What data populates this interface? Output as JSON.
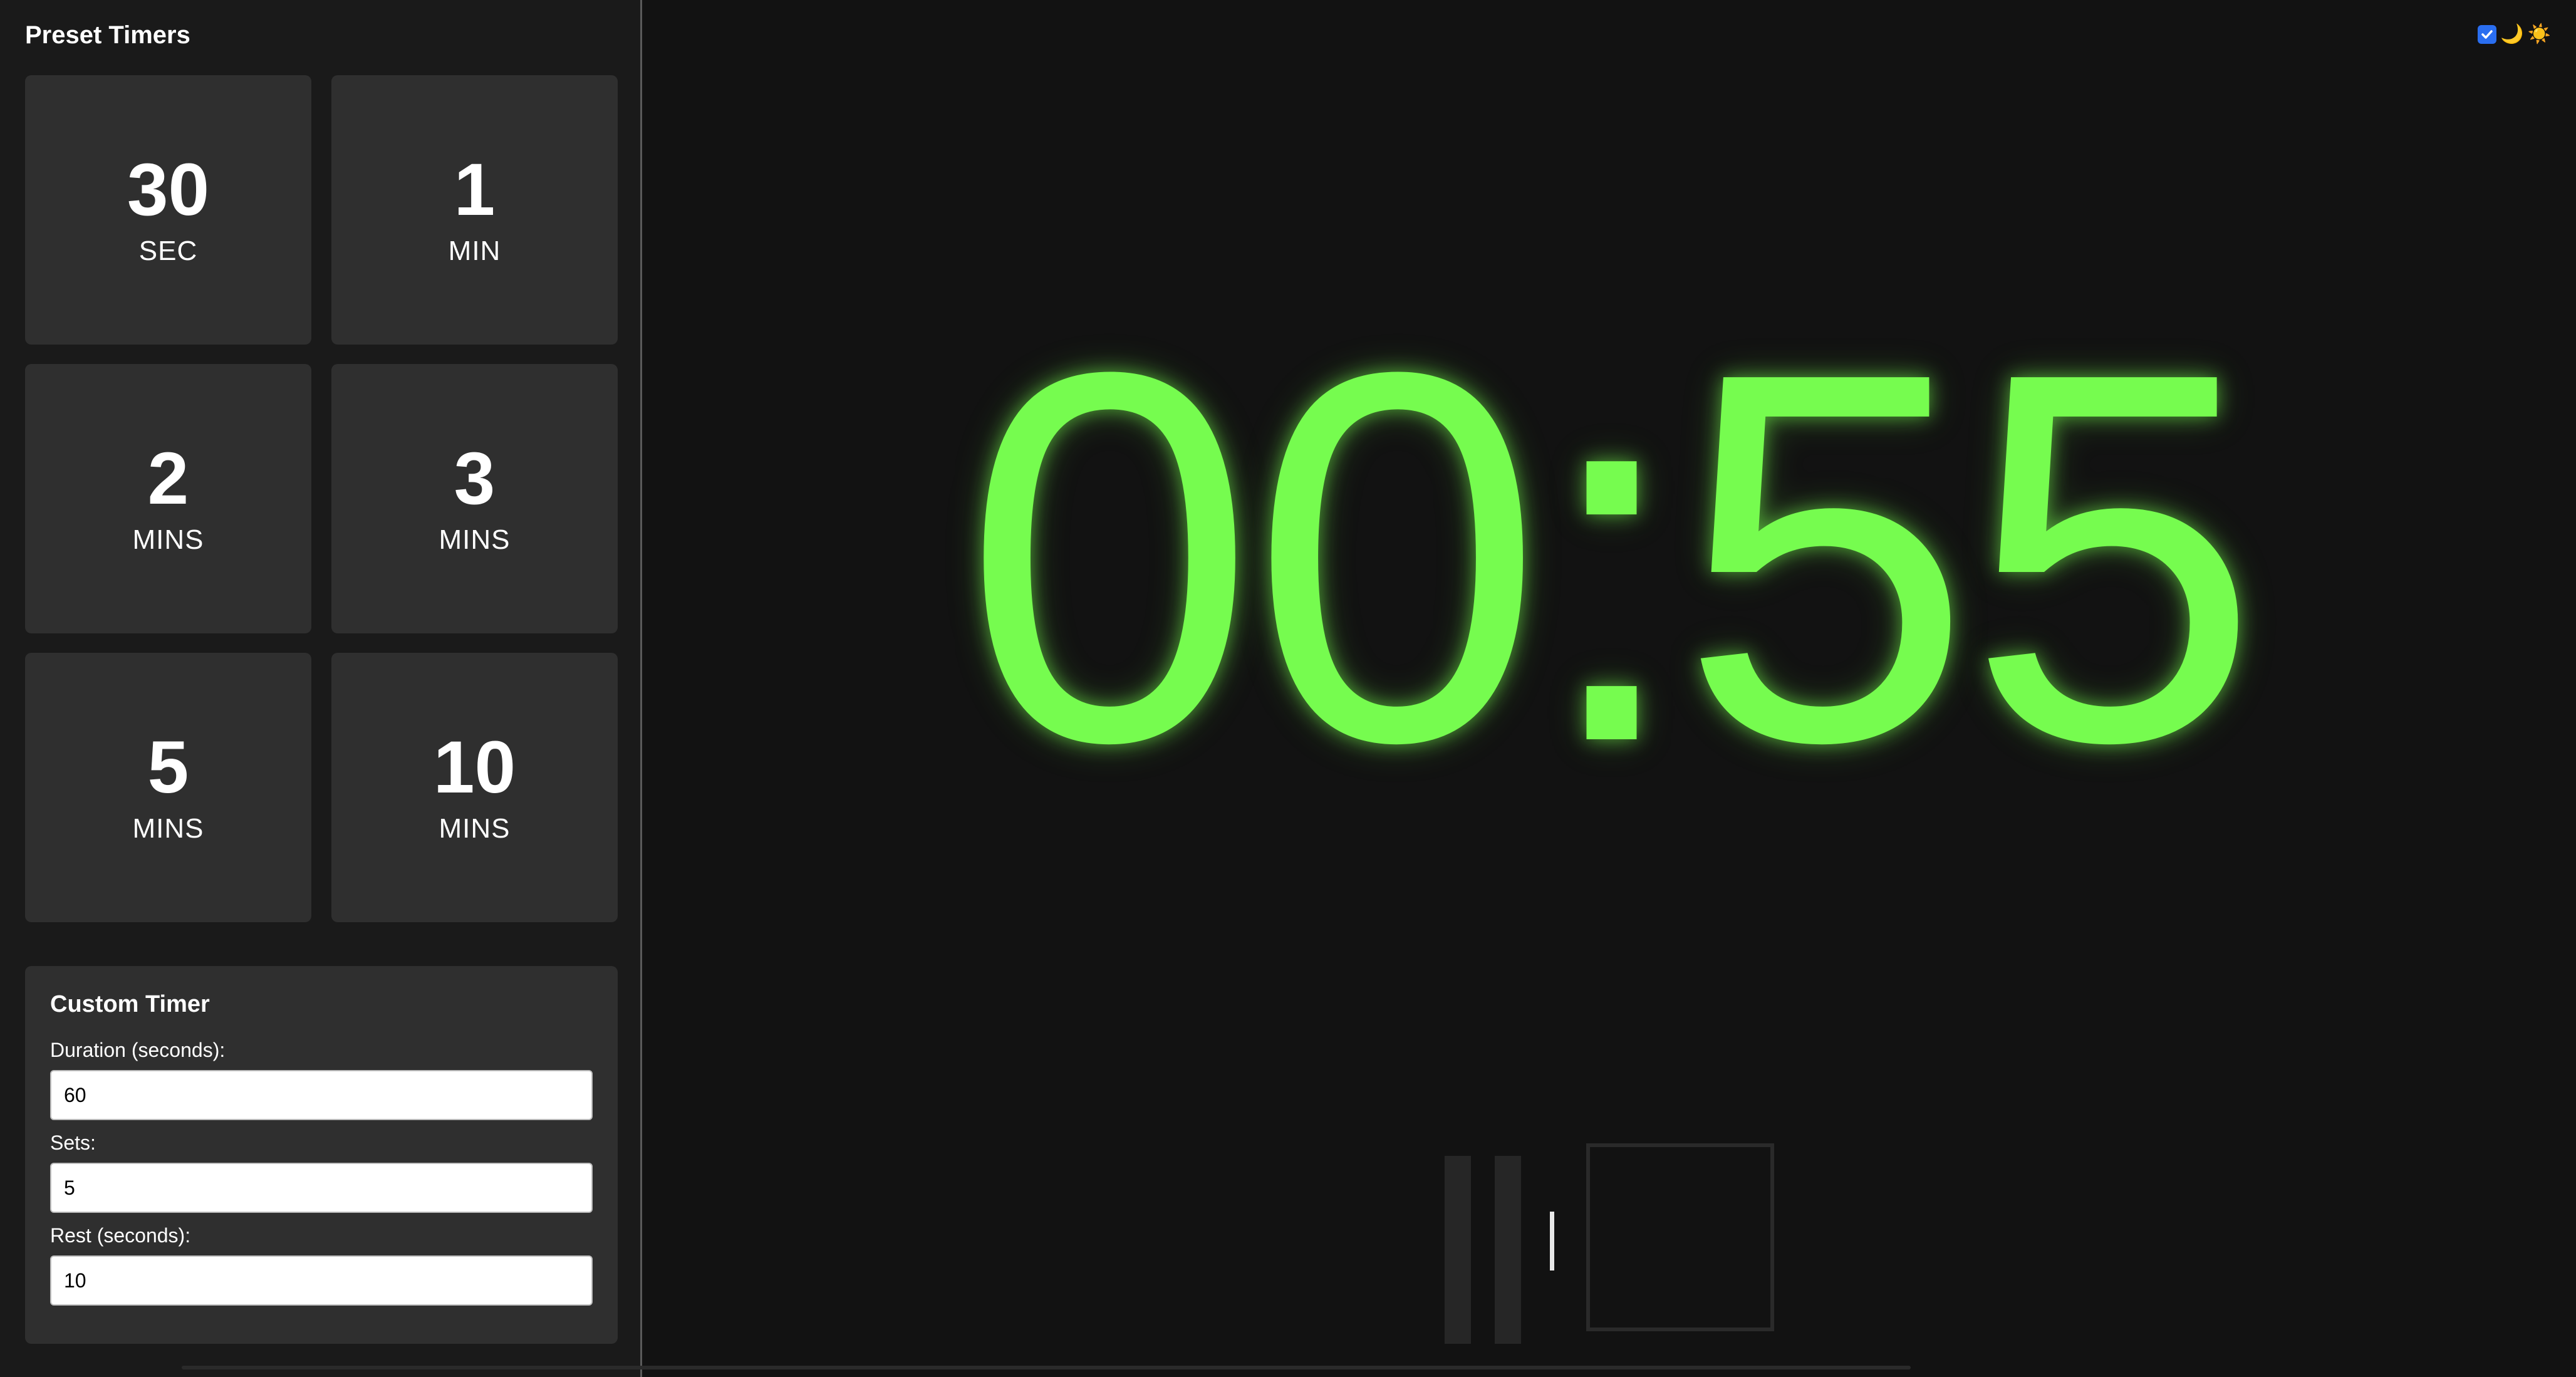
{
  "sidebar": {
    "title": "Preset Timers",
    "presets": [
      {
        "value": "30",
        "unit": "SEC"
      },
      {
        "value": "1",
        "unit": "MIN"
      },
      {
        "value": "2",
        "unit": "MINS"
      },
      {
        "value": "3",
        "unit": "MINS"
      },
      {
        "value": "5",
        "unit": "MINS"
      },
      {
        "value": "10",
        "unit": "MINS"
      }
    ]
  },
  "custom_timer": {
    "title": "Custom Timer",
    "duration_label": "Duration (seconds):",
    "duration_value": "60",
    "sets_label": "Sets:",
    "sets_value": "5",
    "rest_label": "Rest (seconds):",
    "rest_value": "10"
  },
  "theme_toggle": {
    "checked": true,
    "moon_icon": "moon-icon",
    "sun_icon": "sun-icon",
    "moon_glyph": "🌙",
    "sun_glyph": "☀️"
  },
  "timer": {
    "display": "00:55",
    "color": "#76fc4f"
  },
  "controls": {
    "pause_icon": "pause-icon",
    "stop_icon": "stop-icon"
  }
}
